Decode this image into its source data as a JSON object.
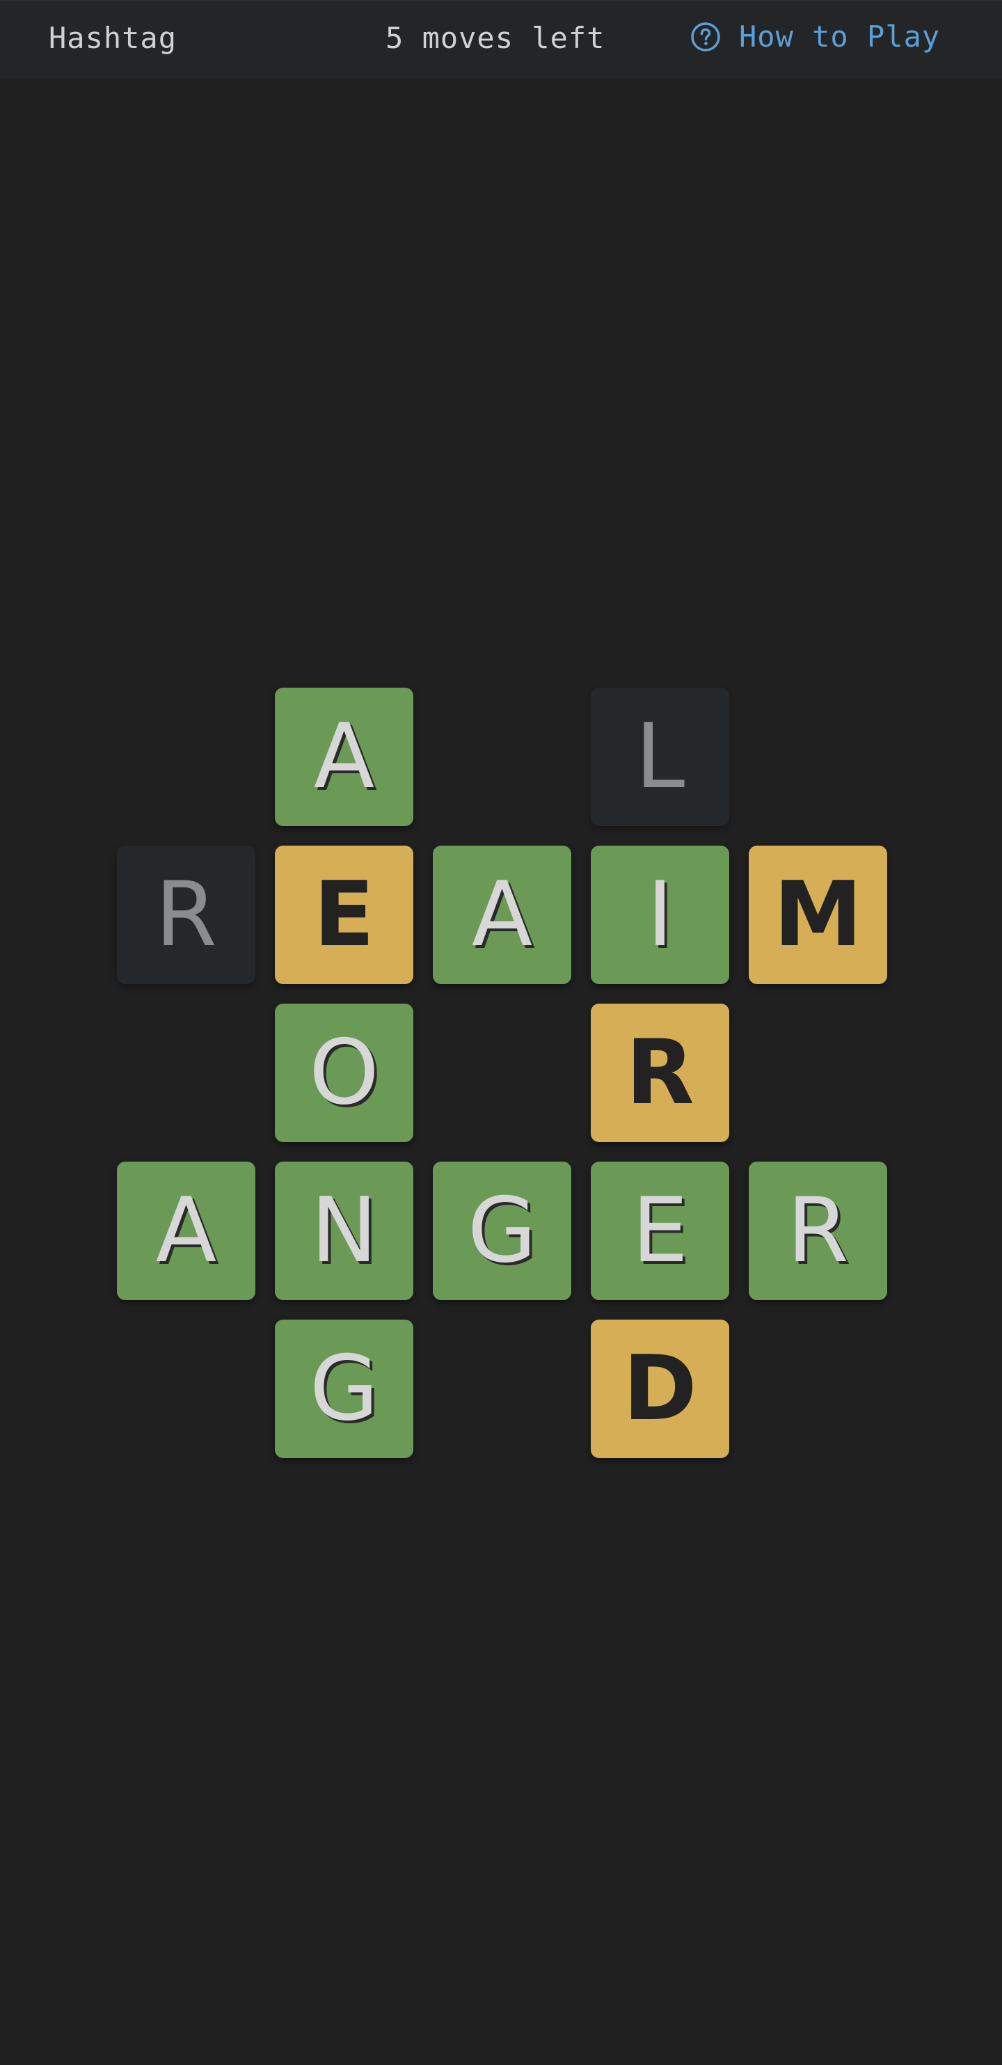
{
  "header": {
    "title": "Hashtag",
    "moves_text": "5 moves left",
    "help_label": "How to Play",
    "help_icon": "question-circle-icon",
    "help_color": "#5b9fd8"
  },
  "colors": {
    "background": "#202020",
    "correct": "#6a9a55",
    "present": "#d6ae55",
    "absent": "#25282a"
  },
  "board": {
    "rows": [
      {
        "cells": [
          null,
          {
            "letter": "A",
            "state": "correct"
          },
          null,
          {
            "letter": "L",
            "state": "absent"
          },
          null
        ]
      },
      {
        "cells": [
          {
            "letter": "R",
            "state": "absent"
          },
          {
            "letter": "E",
            "state": "present"
          },
          {
            "letter": "A",
            "state": "correct"
          },
          {
            "letter": "I",
            "state": "correct"
          },
          {
            "letter": "M",
            "state": "present"
          }
        ]
      },
      {
        "cells": [
          null,
          {
            "letter": "O",
            "state": "correct"
          },
          null,
          {
            "letter": "R",
            "state": "present"
          },
          null
        ]
      },
      {
        "cells": [
          {
            "letter": "A",
            "state": "correct"
          },
          {
            "letter": "N",
            "state": "correct"
          },
          {
            "letter": "G",
            "state": "correct"
          },
          {
            "letter": "E",
            "state": "correct"
          },
          {
            "letter": "R",
            "state": "correct"
          }
        ]
      },
      {
        "cells": [
          null,
          {
            "letter": "G",
            "state": "correct"
          },
          null,
          {
            "letter": "D",
            "state": "present"
          },
          null
        ]
      }
    ]
  }
}
